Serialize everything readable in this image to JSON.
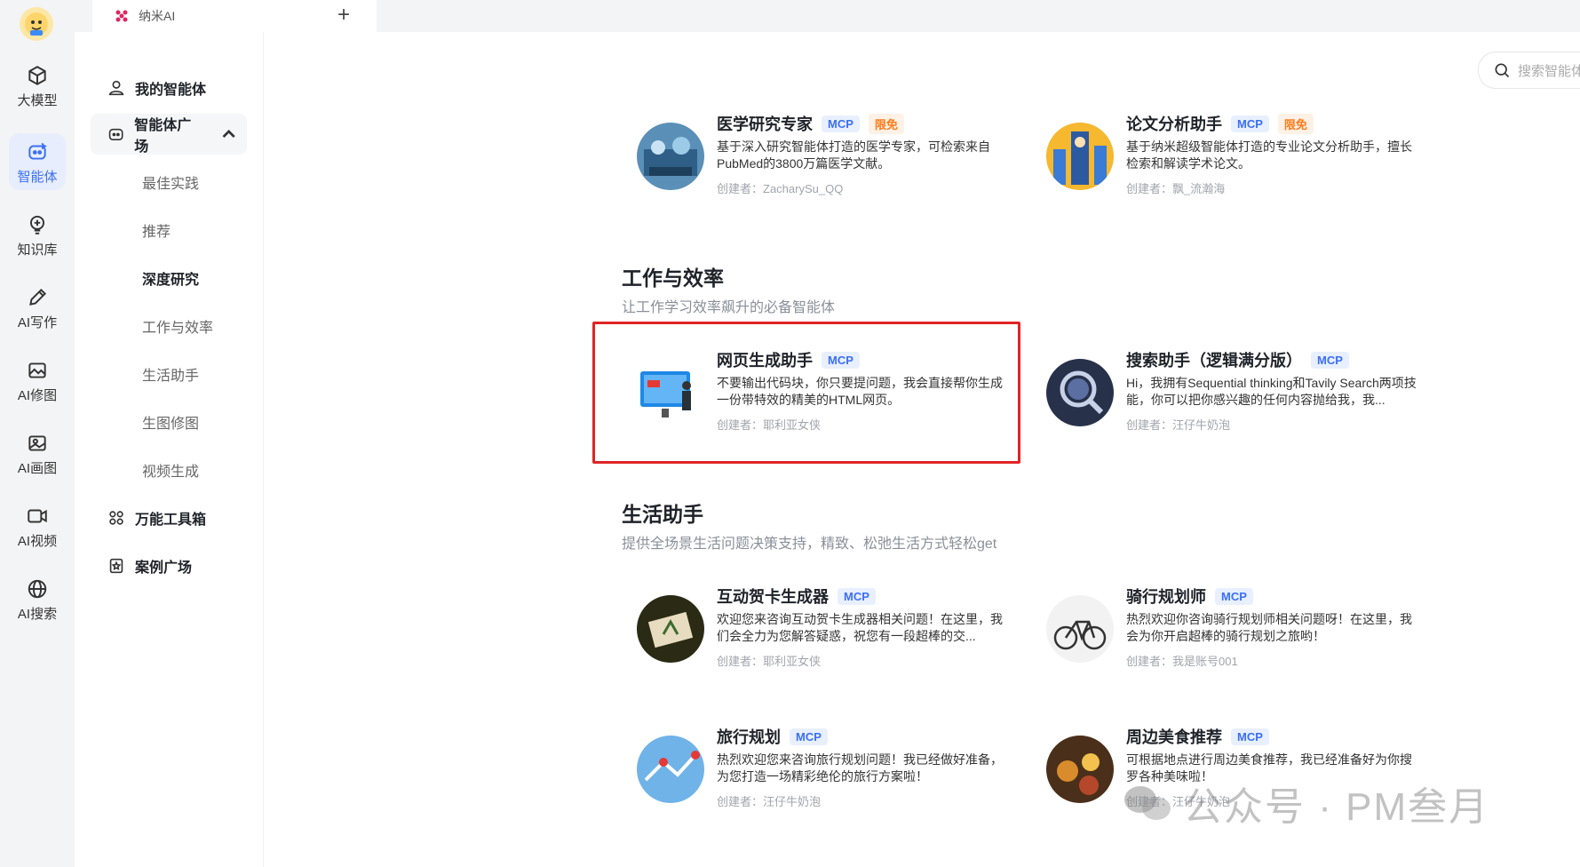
{
  "tabbar": {
    "tab_title": "纳米AI",
    "add_label": "+"
  },
  "rail": {
    "items": [
      {
        "label": "大模型"
      },
      {
        "label": "智能体"
      },
      {
        "label": "知识库"
      },
      {
        "label": "AI写作"
      },
      {
        "label": "AI修图"
      },
      {
        "label": "AI画图"
      },
      {
        "label": "AI视频"
      },
      {
        "label": "AI搜索"
      }
    ]
  },
  "sidebar": {
    "my_agents": "我的智能体",
    "plaza": "智能体广场",
    "sub": [
      "最佳实践",
      "推荐",
      "深度研究",
      "工作与效率",
      "生活助手",
      "生图修图",
      "视频生成"
    ],
    "toolbox": "万能工具箱",
    "cases": "案例广场"
  },
  "search": {
    "placeholder": "搜索智能体"
  },
  "badges": {
    "mcp": "MCP",
    "free": "限免"
  },
  "top_cards": [
    {
      "name": "医学研究专家",
      "desc": "基于深入研究智能体打造的医学专家，可检索来自PubMed的3800万篇医学文献。",
      "creator": "创建者：ZacharySu_QQ"
    },
    {
      "name": "论文分析助手",
      "desc": "基于纳米超级智能体打造的专业论文分析助手，擅长检索和解读学术论文。",
      "creator": "创建者：飘_流瀚海"
    }
  ],
  "work": {
    "title": "工作与效率",
    "subtitle": "让工作学习效率飙升的必备智能体",
    "cards": [
      {
        "name": "网页生成助手",
        "desc": "不要输出代码块，你只要提问题，我会直接帮你生成一份带特效的精美的HTML网页。",
        "creator": "创建者：耶利亚女侠"
      },
      {
        "name": "搜索助手（逻辑满分版）",
        "desc": "Hi，我拥有Sequential thinking和Tavily Search两项技能，你可以把你感兴趣的任何内容抛给我，我...",
        "creator": "创建者：汪仔牛奶泡"
      }
    ]
  },
  "life": {
    "title": "生活助手",
    "subtitle": "提供全场景生活问题决策支持，精致、松弛生活方式轻松get",
    "cards": [
      {
        "name": "互动贺卡生成器",
        "desc": "欢迎您来咨询互动贺卡生成器相关问题！在这里，我们会全力为您解答疑惑，祝您有一段超棒的交...",
        "creator": "创建者：耶利亚女侠"
      },
      {
        "name": "骑行规划师",
        "desc": "热烈欢迎你咨询骑行规划师相关问题呀！在这里，我会为你开启超棒的骑行规划之旅哟！",
        "creator": "创建者：我是账号001"
      },
      {
        "name": "旅行规划",
        "desc": "热烈欢迎您来咨询旅行规划问题！我已经做好准备，为您打造一场精彩绝伦的旅行方案啦！",
        "creator": "创建者：汪仔牛奶泡"
      },
      {
        "name": "周边美食推荐",
        "desc": "可根据地点进行周边美食推荐，我已经准备好为你搜罗各种美味啦！",
        "creator": "创建者：汪仔牛奶泡"
      }
    ]
  },
  "watermark": "公众号 · PM叁月"
}
